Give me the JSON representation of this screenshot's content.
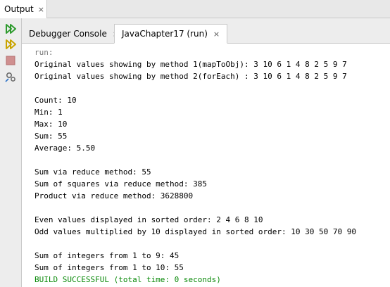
{
  "output_tab": {
    "label": "Output",
    "close": "×"
  },
  "tabs": [
    {
      "label": "Debugger Console",
      "close": "×"
    },
    {
      "label": "JavaChapter17 (run)",
      "close": "×"
    }
  ],
  "console": {
    "run": "run:",
    "method1": "Original values showing by method 1(mapToObj): 3 10 6 1 4 8 2 5 9 7",
    "method2": "Original values showing by method 2(forEach) : 3 10 6 1 4 8 2 5 9 7",
    "count": "Count: 10",
    "min": "Min: 1",
    "max": "Max: 10",
    "sum": "Sum: 55",
    "average": "Average: 5.50",
    "reduce_sum": "Sum via reduce method: 55",
    "reduce_squares": "Sum of squares via reduce method: 385",
    "reduce_product": "Product via reduce method: 3628800",
    "even_sorted": "Even values displayed in sorted order: 2 4 6 8 10",
    "odd_times10": "Odd values multiplied by 10 displayed in sorted order: 10 30 50 70 90",
    "sum_1_9": "Sum of integers from 1 to 9: 45",
    "sum_1_10": "Sum of integers from 1 to 10: 55",
    "build": "BUILD SUCCESSFUL (total time: 0 seconds)"
  },
  "colors": {
    "build_text": "#0a8a0a",
    "run_text": "#7a7a7a",
    "toolbar_green": "#2e9b2e"
  }
}
